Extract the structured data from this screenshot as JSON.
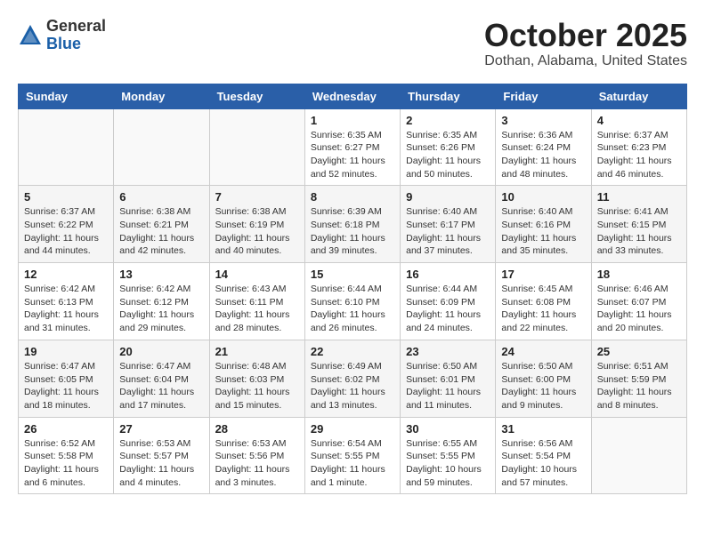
{
  "header": {
    "logo_general": "General",
    "logo_blue": "Blue",
    "month_title": "October 2025",
    "location": "Dothan, Alabama, United States"
  },
  "weekdays": [
    "Sunday",
    "Monday",
    "Tuesday",
    "Wednesday",
    "Thursday",
    "Friday",
    "Saturday"
  ],
  "weeks": [
    [
      {
        "day": "",
        "info": ""
      },
      {
        "day": "",
        "info": ""
      },
      {
        "day": "",
        "info": ""
      },
      {
        "day": "1",
        "info": "Sunrise: 6:35 AM\nSunset: 6:27 PM\nDaylight: 11 hours\nand 52 minutes."
      },
      {
        "day": "2",
        "info": "Sunrise: 6:35 AM\nSunset: 6:26 PM\nDaylight: 11 hours\nand 50 minutes."
      },
      {
        "day": "3",
        "info": "Sunrise: 6:36 AM\nSunset: 6:24 PM\nDaylight: 11 hours\nand 48 minutes."
      },
      {
        "day": "4",
        "info": "Sunrise: 6:37 AM\nSunset: 6:23 PM\nDaylight: 11 hours\nand 46 minutes."
      }
    ],
    [
      {
        "day": "5",
        "info": "Sunrise: 6:37 AM\nSunset: 6:22 PM\nDaylight: 11 hours\nand 44 minutes."
      },
      {
        "day": "6",
        "info": "Sunrise: 6:38 AM\nSunset: 6:21 PM\nDaylight: 11 hours\nand 42 minutes."
      },
      {
        "day": "7",
        "info": "Sunrise: 6:38 AM\nSunset: 6:19 PM\nDaylight: 11 hours\nand 40 minutes."
      },
      {
        "day": "8",
        "info": "Sunrise: 6:39 AM\nSunset: 6:18 PM\nDaylight: 11 hours\nand 39 minutes."
      },
      {
        "day": "9",
        "info": "Sunrise: 6:40 AM\nSunset: 6:17 PM\nDaylight: 11 hours\nand 37 minutes."
      },
      {
        "day": "10",
        "info": "Sunrise: 6:40 AM\nSunset: 6:16 PM\nDaylight: 11 hours\nand 35 minutes."
      },
      {
        "day": "11",
        "info": "Sunrise: 6:41 AM\nSunset: 6:15 PM\nDaylight: 11 hours\nand 33 minutes."
      }
    ],
    [
      {
        "day": "12",
        "info": "Sunrise: 6:42 AM\nSunset: 6:13 PM\nDaylight: 11 hours\nand 31 minutes."
      },
      {
        "day": "13",
        "info": "Sunrise: 6:42 AM\nSunset: 6:12 PM\nDaylight: 11 hours\nand 29 minutes."
      },
      {
        "day": "14",
        "info": "Sunrise: 6:43 AM\nSunset: 6:11 PM\nDaylight: 11 hours\nand 28 minutes."
      },
      {
        "day": "15",
        "info": "Sunrise: 6:44 AM\nSunset: 6:10 PM\nDaylight: 11 hours\nand 26 minutes."
      },
      {
        "day": "16",
        "info": "Sunrise: 6:44 AM\nSunset: 6:09 PM\nDaylight: 11 hours\nand 24 minutes."
      },
      {
        "day": "17",
        "info": "Sunrise: 6:45 AM\nSunset: 6:08 PM\nDaylight: 11 hours\nand 22 minutes."
      },
      {
        "day": "18",
        "info": "Sunrise: 6:46 AM\nSunset: 6:07 PM\nDaylight: 11 hours\nand 20 minutes."
      }
    ],
    [
      {
        "day": "19",
        "info": "Sunrise: 6:47 AM\nSunset: 6:05 PM\nDaylight: 11 hours\nand 18 minutes."
      },
      {
        "day": "20",
        "info": "Sunrise: 6:47 AM\nSunset: 6:04 PM\nDaylight: 11 hours\nand 17 minutes."
      },
      {
        "day": "21",
        "info": "Sunrise: 6:48 AM\nSunset: 6:03 PM\nDaylight: 11 hours\nand 15 minutes."
      },
      {
        "day": "22",
        "info": "Sunrise: 6:49 AM\nSunset: 6:02 PM\nDaylight: 11 hours\nand 13 minutes."
      },
      {
        "day": "23",
        "info": "Sunrise: 6:50 AM\nSunset: 6:01 PM\nDaylight: 11 hours\nand 11 minutes."
      },
      {
        "day": "24",
        "info": "Sunrise: 6:50 AM\nSunset: 6:00 PM\nDaylight: 11 hours\nand 9 minutes."
      },
      {
        "day": "25",
        "info": "Sunrise: 6:51 AM\nSunset: 5:59 PM\nDaylight: 11 hours\nand 8 minutes."
      }
    ],
    [
      {
        "day": "26",
        "info": "Sunrise: 6:52 AM\nSunset: 5:58 PM\nDaylight: 11 hours\nand 6 minutes."
      },
      {
        "day": "27",
        "info": "Sunrise: 6:53 AM\nSunset: 5:57 PM\nDaylight: 11 hours\nand 4 minutes."
      },
      {
        "day": "28",
        "info": "Sunrise: 6:53 AM\nSunset: 5:56 PM\nDaylight: 11 hours\nand 3 minutes."
      },
      {
        "day": "29",
        "info": "Sunrise: 6:54 AM\nSunset: 5:55 PM\nDaylight: 11 hours\nand 1 minute."
      },
      {
        "day": "30",
        "info": "Sunrise: 6:55 AM\nSunset: 5:55 PM\nDaylight: 10 hours\nand 59 minutes."
      },
      {
        "day": "31",
        "info": "Sunrise: 6:56 AM\nSunset: 5:54 PM\nDaylight: 10 hours\nand 57 minutes."
      },
      {
        "day": "",
        "info": ""
      }
    ]
  ]
}
